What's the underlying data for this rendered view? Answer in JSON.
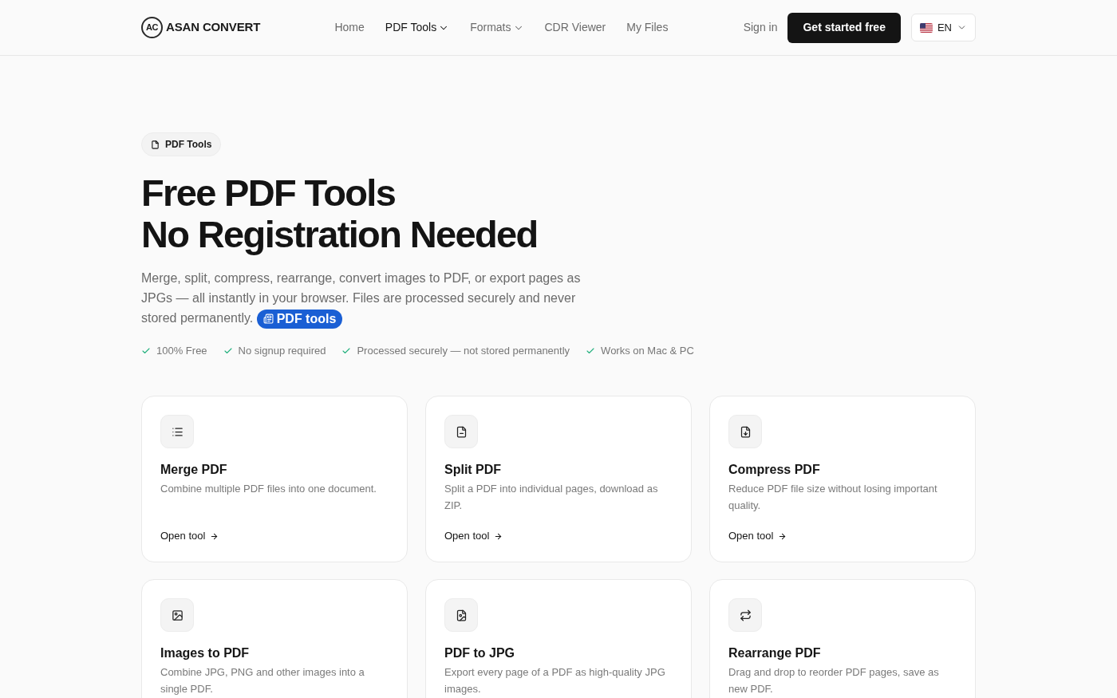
{
  "header": {
    "logo": {
      "monogram": "AC",
      "name": "ASAN CONVERT"
    },
    "nav": [
      {
        "label": "Home",
        "selected": false,
        "dropdown": false
      },
      {
        "label": "PDF Tools",
        "selected": true,
        "dropdown": true
      },
      {
        "label": "Formats",
        "selected": false,
        "dropdown": true
      },
      {
        "label": "CDR Viewer",
        "selected": false,
        "dropdown": false
      },
      {
        "label": "My Files",
        "selected": false,
        "dropdown": false
      }
    ],
    "sign_in": "Sign in",
    "cta": "Get started free",
    "language": "EN"
  },
  "hero": {
    "badge": "PDF Tools",
    "title_lines": [
      "Free PDF Tools",
      "No Registration Needed"
    ],
    "description": "Merge, split, compress, rearrange, convert images to PDF, or export pages as JPGs — all instantly in your browser. Files are processed securely and never stored permanently.",
    "description_link": "PDF tools",
    "features": [
      "100% Free",
      "No signup required",
      "Processed securely — not stored permanently",
      "Works on Mac & PC"
    ]
  },
  "tools": [
    {
      "kind": "merge",
      "title": "Merge PDF",
      "description": "Combine multiple PDF files into one document.",
      "link": "Open tool"
    },
    {
      "kind": "split",
      "title": "Split PDF",
      "description": "Split a PDF into individual pages, download as ZIP.",
      "link": "Open tool"
    },
    {
      "kind": "compress",
      "title": "Compress PDF",
      "description": "Reduce PDF file size without losing important quality.",
      "link": "Open tool"
    },
    {
      "kind": "images",
      "title": "Images to PDF",
      "description": "Combine JPG, PNG and other images into a single PDF."
    },
    {
      "kind": "jpg",
      "title": "PDF to JPG",
      "description": "Export every page of a PDF as high-quality JPG images."
    },
    {
      "kind": "rearrange",
      "title": "Rearrange PDF",
      "description": "Drag and drop to reorder PDF pages, save as new PDF."
    }
  ]
}
